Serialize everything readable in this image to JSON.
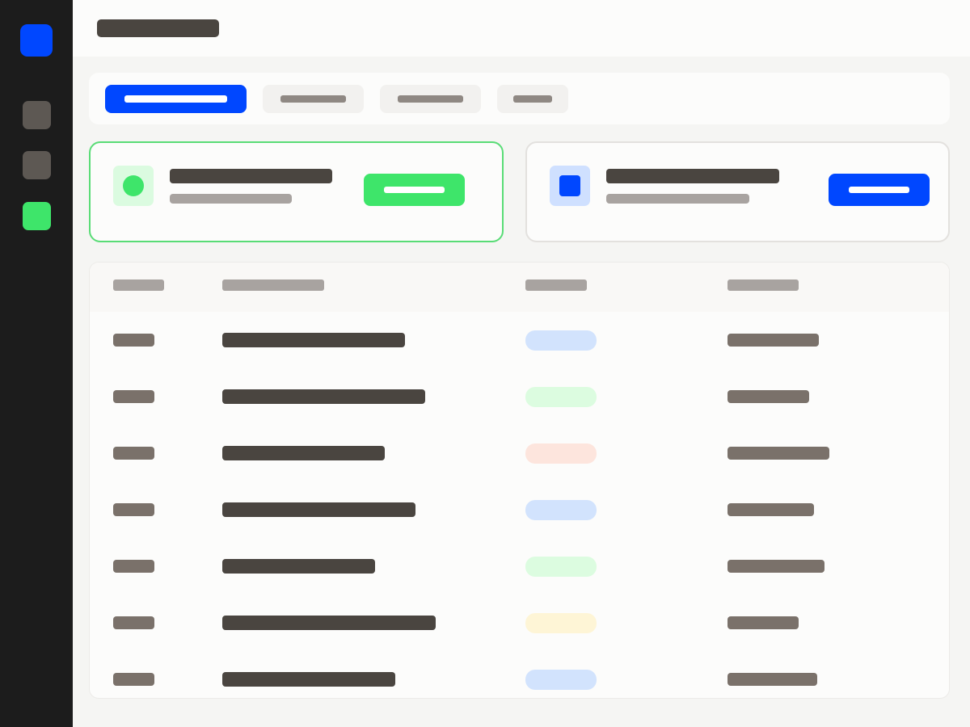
{
  "colors": {
    "sidebar_bg": "#1c1c1c",
    "accent_blue": "#0047ff",
    "accent_green": "#3ee56a",
    "nav_gray": "#5d5853",
    "text_dark": "#4a4540",
    "text_mid": "#7a716a",
    "text_light": "#a8a3a0",
    "tab_inactive_bg": "#f2f1ef",
    "tab_inactive_text": "#8f8883",
    "card_border_active": "#59dc76",
    "card_border_default": "#e3e1de"
  },
  "sidebar": {
    "logo": {
      "icon": "app-logo-icon",
      "color": "#0047ff"
    },
    "items": [
      {
        "name": "nav-item-1",
        "color": "#5d5853",
        "active": false
      },
      {
        "name": "nav-item-2",
        "color": "#5d5853",
        "active": false
      },
      {
        "name": "nav-item-3",
        "color": "#3ee56a",
        "active": true
      }
    ]
  },
  "header": {
    "title_placeholder": "title-bar"
  },
  "tabs": [
    {
      "name": "tab-1",
      "active": true
    },
    {
      "name": "tab-2",
      "active": false
    },
    {
      "name": "tab-3",
      "active": false
    },
    {
      "name": "tab-4",
      "active": false
    }
  ],
  "cards": [
    {
      "name": "card-green",
      "selected": true,
      "icon": "status-dot-icon",
      "icon_color": "#3ee56a",
      "icon_bg": "#dbfbe0",
      "button_color": "#3ee56a"
    },
    {
      "name": "card-blue",
      "selected": false,
      "icon": "square-icon",
      "icon_color": "#0047ff",
      "icon_bg": "#cfe0ff",
      "button_color": "#0047ff"
    }
  ],
  "table": {
    "column_count": 4,
    "rows": [
      {
        "status_color": "#d2e3fd"
      },
      {
        "status_color": "#dcfce0"
      },
      {
        "status_color": "#fde5dd"
      },
      {
        "status_color": "#d2e3fd"
      },
      {
        "status_color": "#dcfce0"
      },
      {
        "status_color": "#fef5d6"
      },
      {
        "status_color": "#d2e3fd"
      }
    ]
  }
}
